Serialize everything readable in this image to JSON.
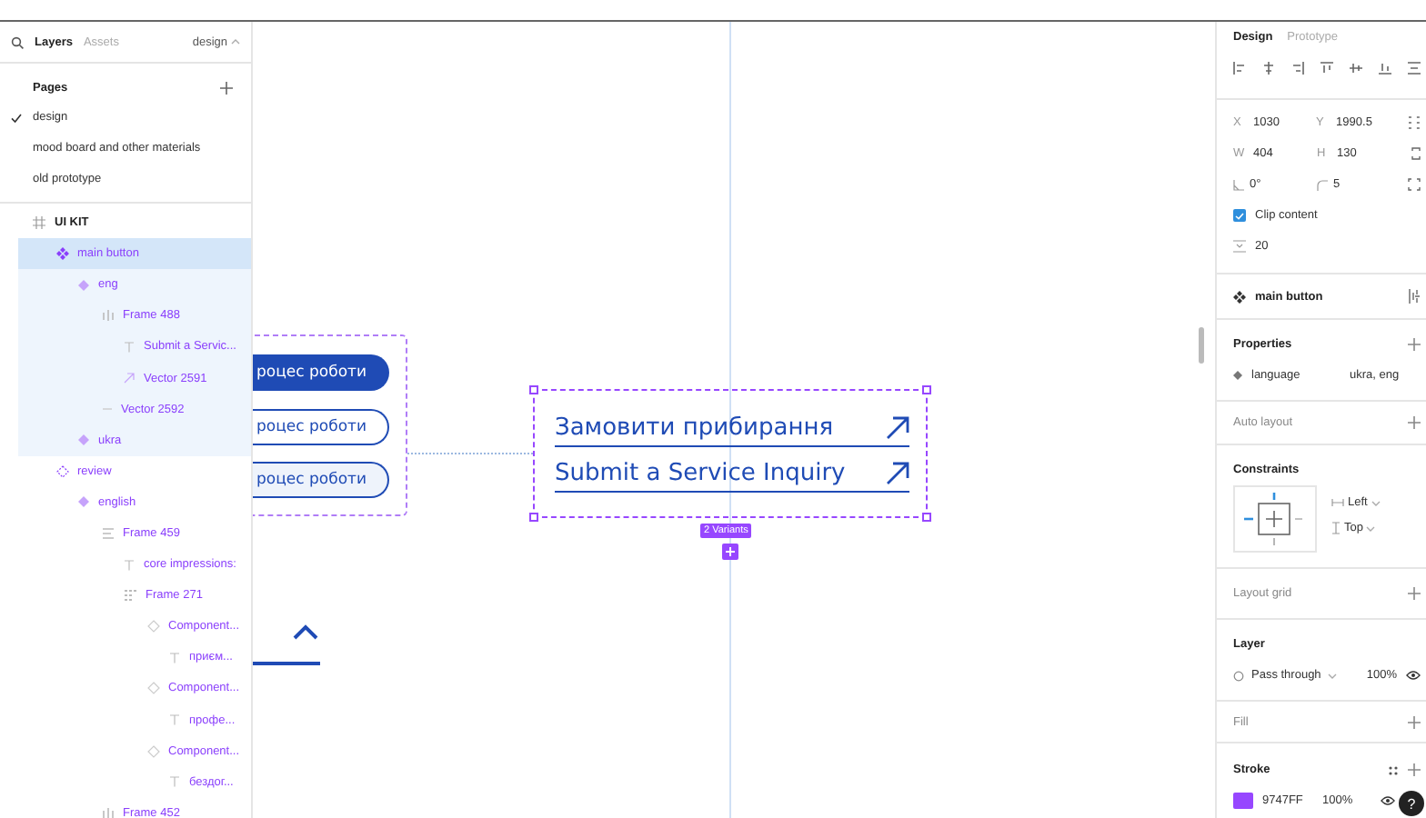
{
  "left_panel": {
    "tabs": [
      {
        "label": "Layers",
        "selected": true
      },
      {
        "label": "Assets",
        "selected": false
      }
    ],
    "page_switcher": "design",
    "pages_title": "Pages",
    "pages": [
      {
        "label": "design",
        "selected": true
      },
      {
        "label": "mood board and other materials",
        "selected": false
      },
      {
        "label": "old prototype",
        "selected": false
      }
    ],
    "layers": [
      {
        "name": "UI KIT",
        "kind": "frame",
        "selected": false,
        "children": [
          {
            "name": "main button",
            "kind": "component_set",
            "selected": true,
            "children": [
              {
                "name": "eng",
                "kind": "variant",
                "selected": false,
                "children": [
                  {
                    "name": "Frame 488",
                    "kind": "row_layout",
                    "selected": false,
                    "children": [
                      {
                        "name": "Submit a Servic...",
                        "kind": "text",
                        "selected": false
                      },
                      {
                        "name": "Vector 2591",
                        "kind": "vector",
                        "selected": false
                      }
                    ]
                  },
                  {
                    "name": "Vector 2592",
                    "kind": "line",
                    "selected": false
                  }
                ]
              },
              {
                "name": "ukra",
                "kind": "variant",
                "selected": false
              }
            ]
          },
          {
            "name": "review",
            "kind": "component_set_outline",
            "selected": false,
            "children": [
              {
                "name": "english",
                "kind": "variant",
                "selected": false,
                "children": [
                  {
                    "name": "Frame 459",
                    "kind": "column_layout",
                    "selected": false,
                    "children": [
                      {
                        "name": "core impressions:",
                        "kind": "text",
                        "selected": false
                      },
                      {
                        "name": "Frame 271",
                        "kind": "grid_layout",
                        "selected": false,
                        "children": [
                          {
                            "name": "Component...",
                            "kind": "instance",
                            "selected": false,
                            "children": [
                              {
                                "name": "приєм...",
                                "kind": "text",
                                "selected": false
                              }
                            ]
                          },
                          {
                            "name": "Component...",
                            "kind": "instance",
                            "selected": false,
                            "children": [
                              {
                                "name": "профе...",
                                "kind": "text",
                                "selected": false
                              }
                            ]
                          },
                          {
                            "name": "Component...",
                            "kind": "instance",
                            "selected": false,
                            "children": [
                              {
                                "name": "бездог...",
                                "kind": "text",
                                "selected": false
                              }
                            ]
                          }
                        ]
                      }
                    ]
                  },
                  {
                    "name": "Frame 452",
                    "kind": "row_layout",
                    "selected": false
                  }
                ]
              }
            ]
          }
        ]
      }
    ]
  },
  "canvas": {
    "buttons": [
      {
        "label": "роцес роботи",
        "kind": "filled"
      },
      {
        "label": "роцес роботи",
        "kind": "outline"
      },
      {
        "label": "роцес роботи",
        "kind": "tinted"
      }
    ],
    "selection": {
      "links": [
        "Замовити прибирання",
        "Submit a Service Inquiry"
      ],
      "badge": "2 Variants"
    }
  },
  "right_panel": {
    "tabs": [
      {
        "label": "Design",
        "selected": true
      },
      {
        "label": "Prototype",
        "selected": false
      }
    ],
    "geometry": [
      {
        "label": "X",
        "value": "1030"
      },
      {
        "label": "Y",
        "value": "1990.5"
      },
      {
        "label": "W",
        "value": "404"
      },
      {
        "label": "H",
        "value": "130"
      }
    ],
    "rotation": "0°",
    "radius": "5",
    "clip_content": {
      "label": "Clip content",
      "checked": true
    },
    "spacing": "20",
    "component": "main button",
    "properties": {
      "title": "Properties",
      "items": [
        {
          "name": "language",
          "value": "ukra, eng"
        }
      ]
    },
    "auto_layout": "Auto layout",
    "constraints": {
      "title": "Constraints",
      "horizontal": "Left",
      "vertical": "Top"
    },
    "layout_grid": "Layout grid",
    "layer": {
      "title": "Layer",
      "blend": "Pass through",
      "opacity": "100%"
    },
    "fill": "Fill",
    "stroke": {
      "title": "Stroke",
      "hex": "9747FF",
      "opacity": "100%"
    },
    "help": "?"
  }
}
